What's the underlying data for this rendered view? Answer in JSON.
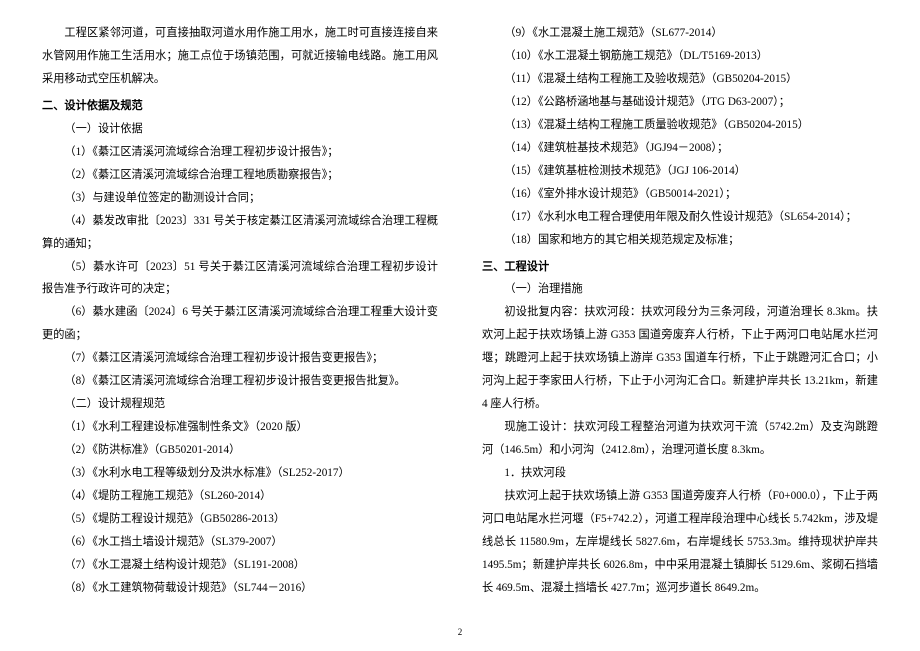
{
  "pageNumber": "2",
  "left": {
    "intro": "工程区紧邻河道，可直接抽取河道水用作施工用水，施工时可直接连接自来水管网用作施工生活用水；施工点位于场镇范围，可就近接输电线路。施工用风采用移动式空压机解决。",
    "h2": "二、设计依据及规范",
    "sub1": "（一）设计依据",
    "d1": "（1）《綦江区清溪河流域综合治理工程初步设计报告》；",
    "d2": "（2）《綦江区清溪河流域综合治理工程地质勘察报告》；",
    "d3": "（3）与建设单位签定的勘测设计合同；",
    "d4": "（4）綦发改审批〔2023〕331 号关于核定綦江区清溪河流域综合治理工程概算的通知；",
    "d5": "（5）綦水许可〔2023〕51 号关于綦江区清溪河流域综合治理工程初步设计报告准予行政许可的决定；",
    "d6": "（6）綦水建函〔2024〕6 号关于綦江区清溪河流域综合治理工程重大设计变更的函；",
    "d7": "（7）《綦江区清溪河流域综合治理工程初步设计报告变更报告》；",
    "d8": "（8）《綦江区清溪河流域综合治理工程初步设计报告变更报告批复》。",
    "sub2": "（二）设计规程规范",
    "s1": "（1）《水利工程建设标准强制性条文》（2020 版）",
    "s2": "（2）《防洪标准》（GB50201-2014）",
    "s3": "（3）《水利水电工程等级划分及洪水标准》（SL252-2017）",
    "s4": "（4）《堤防工程施工规范》（SL260-2014）",
    "s5": "（5）《堤防工程设计规范》（GB50286-2013）",
    "s6": "（6）《水工挡土墙设计规范》（SL379-2007）",
    "s7": "（7）《水工混凝土结构设计规范》（SL191-2008）",
    "s8": "（8）《水工建筑物荷载设计规范》（SL744－2016）"
  },
  "right": {
    "s9": "（9）《水工混凝土施工规范》（SL677-2014）",
    "s10": "（10）《水工混凝土钢筋施工规范》（DL/T5169-2013）",
    "s11": "（11）《混凝土结构工程施工及验收规范》（GB50204-2015）",
    "s12": "（12）《公路桥涵地基与基础设计规范》（JTG D63-2007）；",
    "s13": "（13）《混凝土结构工程施工质量验收规范》（GB50204-2015）",
    "s14": "（14）《建筑桩基技术规范》（JGJ94－2008）；",
    "s15": "（15）《建筑基桩检测技术规范》（JGJ 106-2014）",
    "s16": "（16）《室外排水设计规范》（GB50014-2021）；",
    "s17": "（17）《水利水电工程合理使用年限及耐久性设计规范》（SL654-2014）；",
    "s18": "（18）国家和地方的其它相关规范规定及标准；",
    "h2": "三、工程设计",
    "sub1": "（一）治理措施",
    "p1": "初设批复内容：扶欢河段：扶欢河段分为三条河段，河道治理长 8.3km。扶欢河上起于扶欢场镇上游 G353 国道旁废弃人行桥，下止于两河口电站尾水拦河堰；跳蹬河上起于扶欢场镇上游岸 G353 国道车行桥，下止于跳蹬河汇合口；小河沟上起于李家田人行桥，下止于小河沟汇合口。新建护岸共长 13.21km，新建 4 座人行桥。",
    "p2": "现施工设计：扶欢河段工程整治河道为扶欢河干流（5742.2m）及支沟跳蹬河（146.5m）和小河沟（2412.8m），治理河道长度 8.3km。",
    "p3": "1．扶欢河段",
    "p4": "扶欢河上起于扶欢场镇上游 G353 国道旁废弃人行桥（F0+000.0），下止于两河口电站尾水拦河堰（F5+742.2），河道工程岸段治理中心线长 5.742km，涉及堤线总长 11580.9m，左岸堤线长 5827.6m，右岸堤线长 5753.3m。维持现状护岸共 1495.5m；新建护岸共长 6026.8m，中中采用混凝土镇脚长 5129.6m、浆砌石挡墙长 469.5m、混凝土挡墙长 427.7m；巡河步道长 8649.2m。"
  }
}
